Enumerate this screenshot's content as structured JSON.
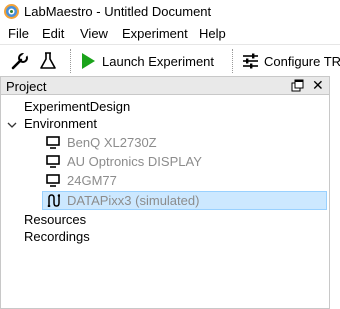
{
  "window": {
    "title": "LabMaestro - Untitled Document",
    "app_icon": "labmaestro-logo-icon"
  },
  "menu": {
    "items": [
      "File",
      "Edit",
      "View",
      "Experiment",
      "Help"
    ]
  },
  "toolbar": {
    "settings_icon": "wrench-icon",
    "lab_icon": "flask-icon",
    "launch_icon": "play-icon",
    "launch_label": "Launch Experiment",
    "configure_icon": "sliders-icon",
    "configure_label": "Configure TRA",
    "launch_color": "#1aa31a"
  },
  "project_panel": {
    "title": "Project",
    "float_icon": "float-window-icon",
    "close_icon": "close-icon",
    "close_glyph": "✕",
    "tree": {
      "experiment_design": "ExperimentDesign",
      "environment": "Environment",
      "devices": [
        {
          "label": "BenQ XL2730Z",
          "icon": "monitor-icon",
          "enabled": false
        },
        {
          "label": "AU Optronics DISPLAY",
          "icon": "monitor-icon",
          "enabled": false
        },
        {
          "label": "24GM77",
          "icon": "monitor-icon",
          "enabled": false
        },
        {
          "label": "DATAPixx3 (simulated)",
          "icon": "datapixx-icon",
          "enabled": false,
          "selected": true
        }
      ],
      "resources": "Resources",
      "recordings": "Recordings"
    },
    "selection_color": "#cce8ff"
  }
}
